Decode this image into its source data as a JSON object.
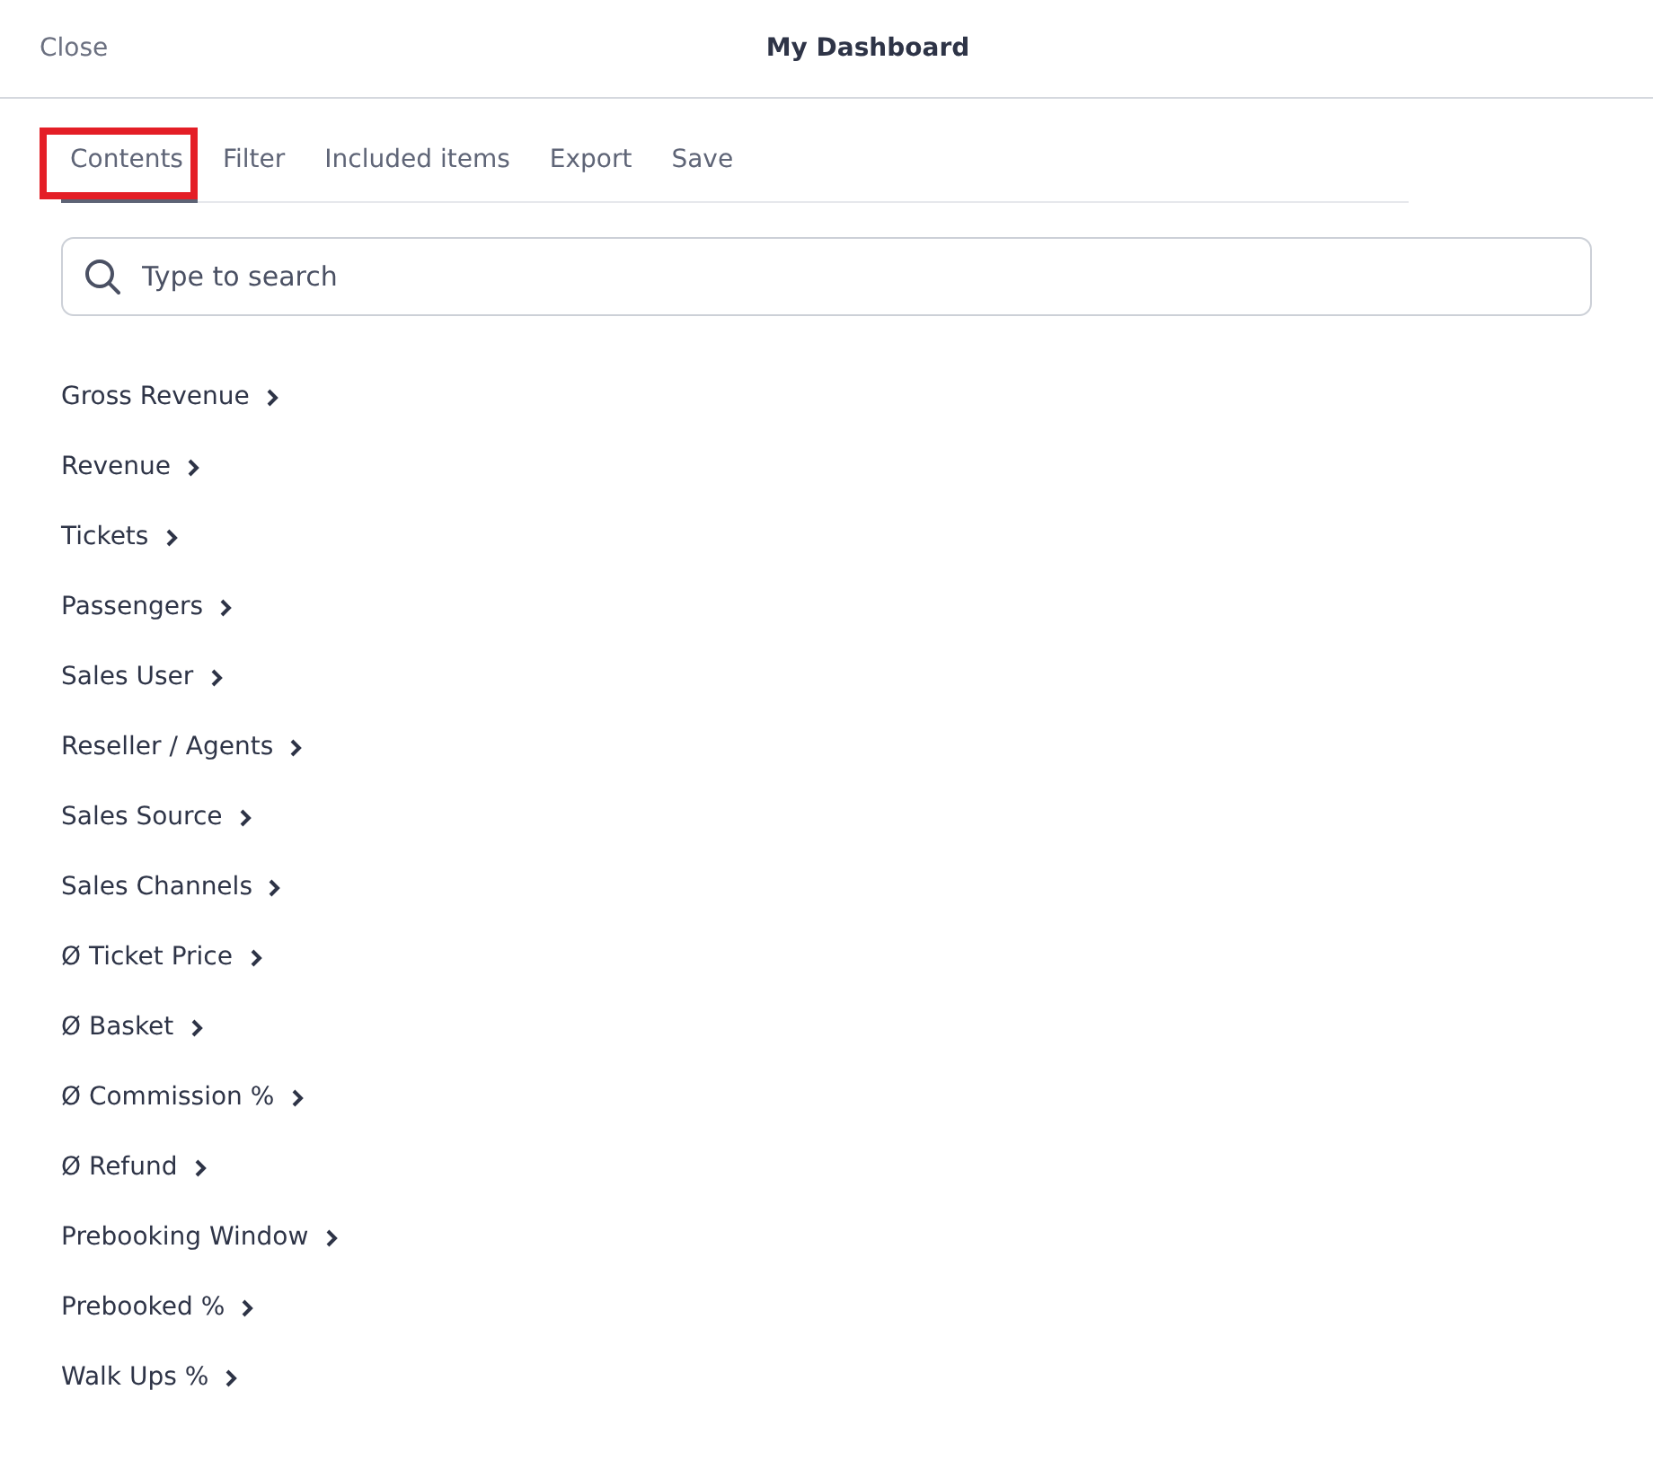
{
  "header": {
    "close": "Close",
    "title": "My Dashboard"
  },
  "tabs": [
    {
      "label": "Contents",
      "selected": true,
      "highlighted": true
    },
    {
      "label": "Filter",
      "selected": false,
      "highlighted": false
    },
    {
      "label": "Included items",
      "selected": false,
      "highlighted": false
    },
    {
      "label": "Export",
      "selected": false,
      "highlighted": false
    },
    {
      "label": "Save",
      "selected": false,
      "highlighted": false
    }
  ],
  "search": {
    "placeholder": "Type to search"
  },
  "items": [
    "Gross Revenue",
    "Revenue",
    "Tickets",
    "Passengers",
    "Sales User",
    "Reseller / Agents",
    "Sales Source",
    "Sales Channels",
    "Ø Ticket Price",
    "Ø Basket",
    "Ø Commission %",
    "Ø Refund",
    "Prebooking Window",
    "Prebooked %",
    "Walk Ups %"
  ]
}
